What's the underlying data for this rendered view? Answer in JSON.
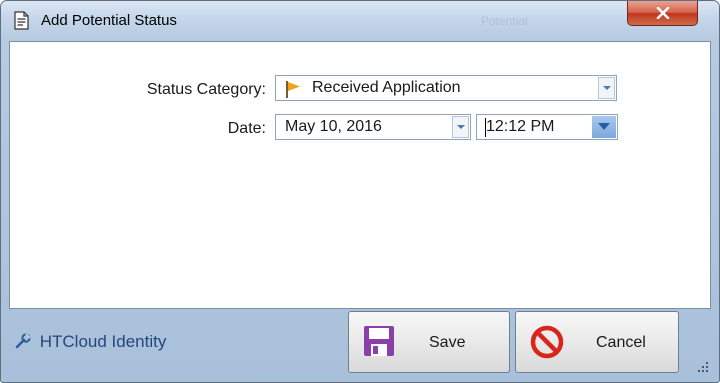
{
  "window": {
    "title": "Add Potential Status",
    "ghost_title": "Potential"
  },
  "form": {
    "status_category_label": "Status Category:",
    "status_category_value": "Received Application",
    "date_label": "Date:",
    "date_value": "May 10, 2016",
    "time_value": "12:12 PM"
  },
  "footer": {
    "identity_label": "HTCloud Identity",
    "save_label": "Save",
    "cancel_label": "Cancel"
  },
  "colors": {
    "flag": "#f0a21d",
    "save_icon": "#8b3fa8",
    "cancel_icon": "#d8261c",
    "link": "#24477e"
  }
}
